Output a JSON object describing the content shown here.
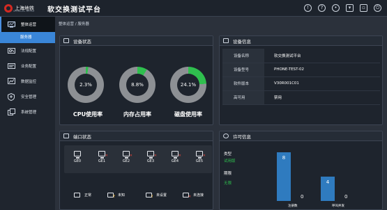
{
  "header": {
    "logo_text": "上海地铁",
    "logo_sub": "SHANGHAI METRO",
    "title": "软交换测试平台",
    "icons": [
      "alert-icon",
      "help-icon",
      "user-icon",
      "mail-icon",
      "window-icon",
      "logout-icon"
    ]
  },
  "sidebar": {
    "items": [
      {
        "label": "整体运营",
        "icon": "monitor-icon"
      },
      {
        "label": "服务器"
      },
      {
        "label": "法规配置",
        "icon": "tools-icon"
      },
      {
        "label": "业务配置",
        "icon": "device-icon"
      },
      {
        "label": "数据监控",
        "icon": "chart-icon"
      },
      {
        "label": "安全管理",
        "icon": "shield-icon"
      },
      {
        "label": "系统管理",
        "icon": "window-icon"
      }
    ]
  },
  "breadcrumb": "整体运营 / 服务器",
  "device_status": {
    "title": "设备状态",
    "gauges": [
      {
        "value": "2.3%",
        "label": "CPU使用率",
        "percent": 2.3
      },
      {
        "value": "8.8%",
        "label": "内存占用率",
        "percent": 8.8
      },
      {
        "value": "24.1%",
        "label": "磁盘使用率",
        "percent": 24.1
      }
    ]
  },
  "device_info": {
    "title": "设备信息",
    "rows": [
      {
        "key": "设备名称",
        "value": "软交换测试平台"
      },
      {
        "key": "设备型号",
        "value": "PHONE-TEST-02"
      },
      {
        "key": "软件版本",
        "value": "V30R001C01"
      },
      {
        "key": "高可用",
        "value": "禁用"
      }
    ]
  },
  "port_status": {
    "title": "端口状态",
    "ports": [
      {
        "label": "GE0",
        "state": "normal"
      },
      {
        "label": "GE1",
        "state": "down"
      },
      {
        "label": "GE2",
        "state": "down"
      },
      {
        "label": "GE3",
        "state": "down"
      },
      {
        "label": "GE4",
        "state": "down"
      },
      {
        "label": "GE5",
        "state": "down"
      }
    ],
    "legend": [
      {
        "label": "正常",
        "state": "normal"
      },
      {
        "label": "未知",
        "state": "unknown"
      },
      {
        "label": "未设置",
        "state": "unset"
      },
      {
        "label": "未连接",
        "state": "down"
      }
    ]
  },
  "license": {
    "title": "许可信息",
    "type_label": "类型",
    "type_value": "试用版",
    "period_label": "期限",
    "period_value": "无限",
    "colors": {
      "bar": "#2f7bbf",
      "accent": "#2fbf4e"
    }
  },
  "chart_data": {
    "type": "bar",
    "categories": [
      "注册数",
      "呼叫并发"
    ],
    "series": [
      {
        "values": [
          8,
          4
        ]
      },
      {
        "values": [
          0,
          0
        ]
      }
    ],
    "xlabel": "",
    "ylabel": ""
  }
}
